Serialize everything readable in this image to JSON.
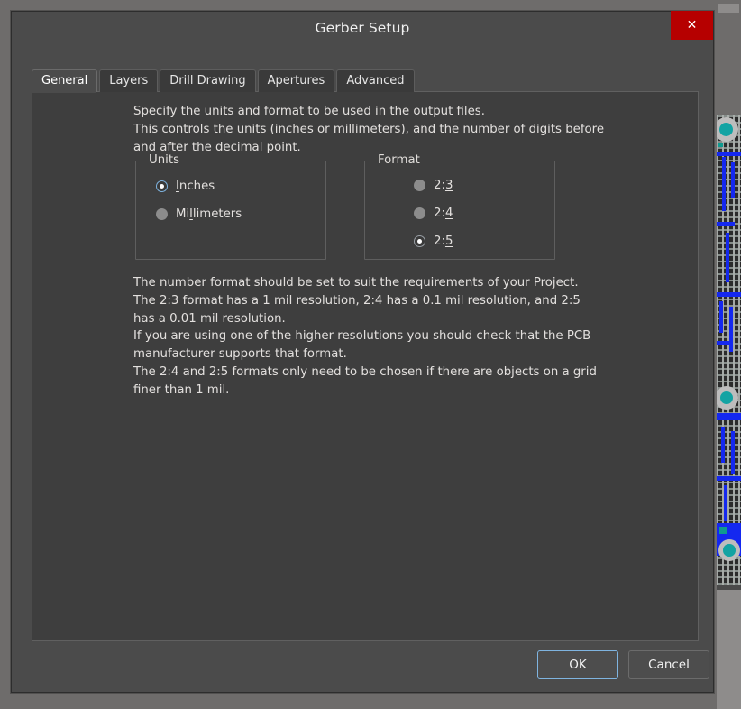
{
  "window": {
    "title": "Gerber Setup",
    "close_label": "✕",
    "close_icon": "close-icon"
  },
  "tabs": [
    {
      "label": "General",
      "active": true
    },
    {
      "label": "Layers",
      "active": false
    },
    {
      "label": "Drill Drawing",
      "active": false
    },
    {
      "label": "Apertures",
      "active": false
    },
    {
      "label": "Advanced",
      "active": false
    }
  ],
  "general": {
    "intro_text": "Specify the units and format to be used in the output files.\nThis controls the units (inches or millimeters), and the number of digits before and after the decimal point.",
    "notes_text": "The number format should be set to suit the requirements of your Project.\nThe 2:3 format has a 1 mil resolution, 2:4 has a 0.1 mil resolution, and 2:5 has a 0.01 mil resolution.\nIf you are using one of the higher resolutions you should check that the PCB manufacturer supports that format.\nThe 2:4 and 2:5 formats only need to be chosen if there are objects on a grid finer than 1 mil.",
    "units_group": {
      "title": "Units",
      "options": [
        {
          "label": "Inches",
          "accel_index": 0,
          "selected": true,
          "focused": true
        },
        {
          "label": "Millimeters",
          "accel_index": 2,
          "selected": false,
          "focused": false
        }
      ]
    },
    "format_group": {
      "title": "Format",
      "options": [
        {
          "label": "2:3",
          "accel_index": 2,
          "selected": false,
          "focused": false
        },
        {
          "label": "2:4",
          "accel_index": 2,
          "selected": false,
          "focused": false
        },
        {
          "label": "2:5",
          "accel_index": 2,
          "selected": true,
          "focused": false
        }
      ]
    }
  },
  "footer": {
    "ok_label": "OK",
    "cancel_label": "Cancel"
  },
  "colors": {
    "window_background": "#6e6c6b",
    "dialog_background": "#4b4b4b",
    "panel_background": "#3e3e3e",
    "text": "#e3e0de",
    "close_button": "#b60000",
    "focus_accent": "#7fb4e0",
    "pcb_trace": "#1428f0",
    "pcb_pad": "#13a3a3"
  }
}
